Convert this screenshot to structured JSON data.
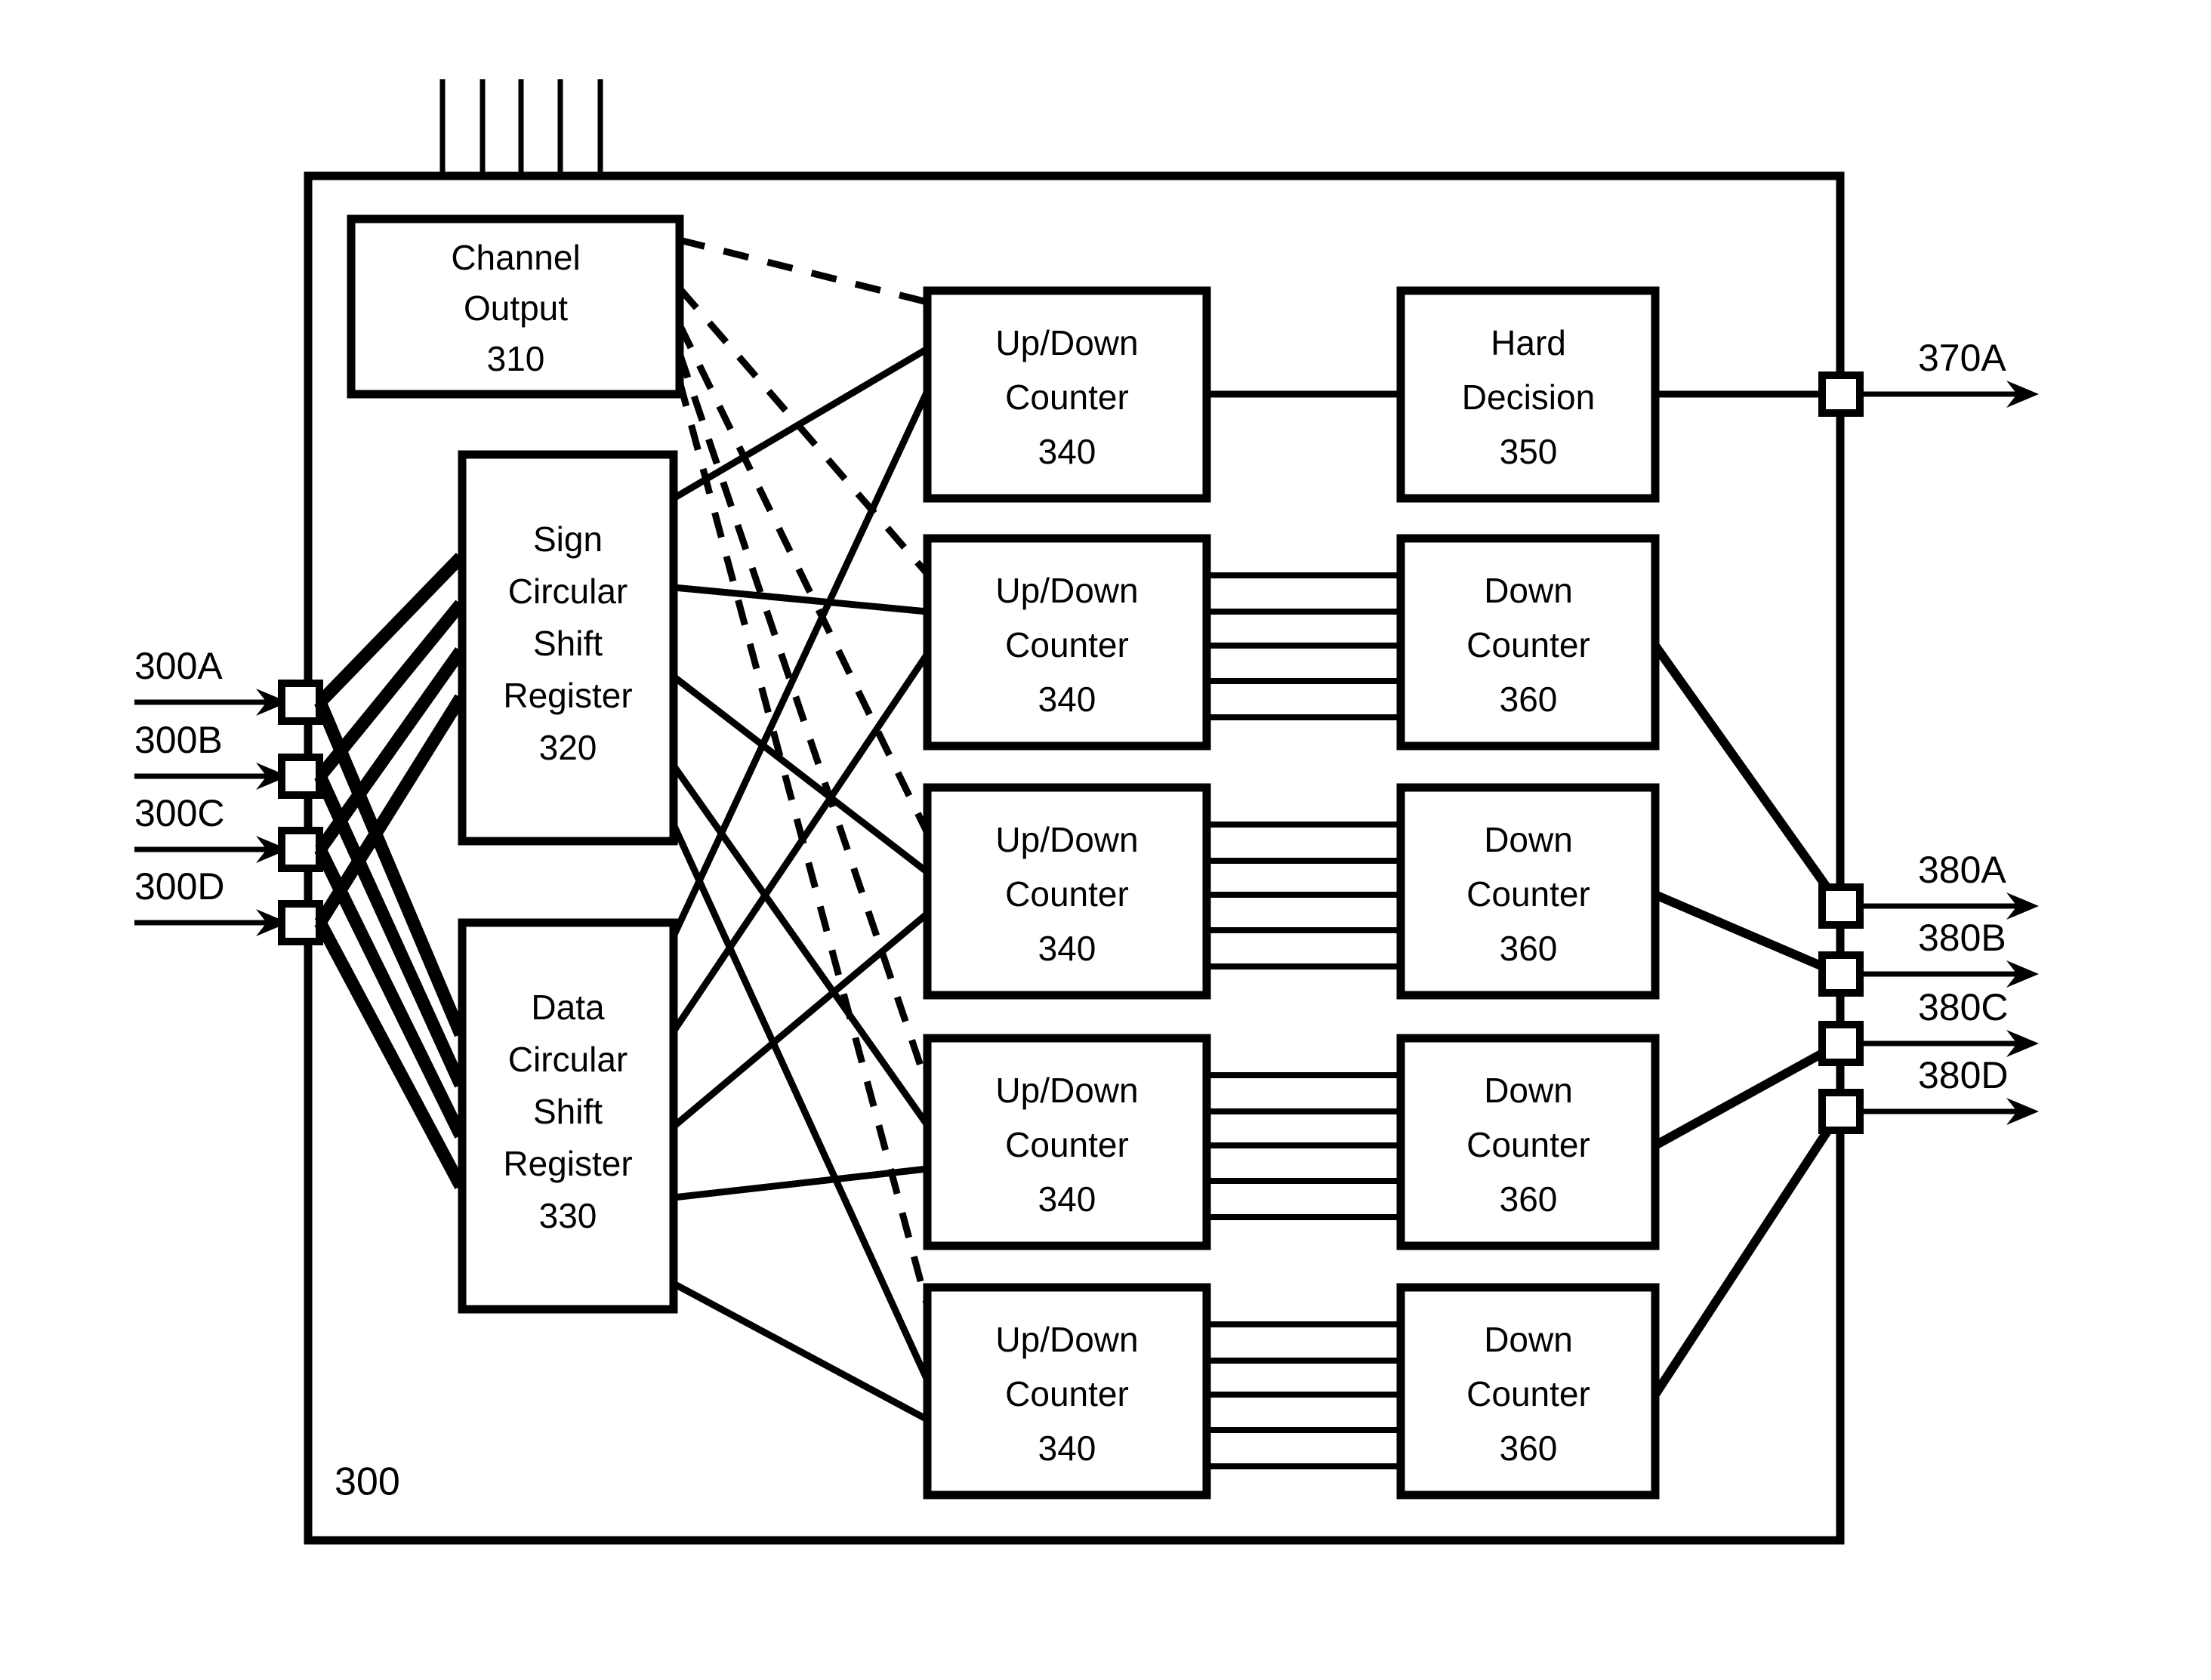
{
  "figure": {
    "outer_label": "300",
    "top_input_arrow_count": 5
  },
  "blocks": {
    "channel_output": {
      "line1": "Channel",
      "line2": "Output",
      "ref": "310"
    },
    "sign_shift_register": {
      "line1": "Sign",
      "line2": "Circular",
      "line3": "Shift",
      "line4": "Register",
      "ref": "320"
    },
    "data_shift_register": {
      "line1": "Data",
      "line2": "Circular",
      "line3": "Shift",
      "line4": "Register",
      "ref": "330"
    },
    "up_down_counter": {
      "line1": "Up/Down",
      "line2": "Counter",
      "ref": "340"
    },
    "hard_decision": {
      "line1": "Hard",
      "line2": "Decision",
      "ref": "350"
    },
    "down_counter": {
      "line1": "Down",
      "line2": "Counter",
      "ref": "360"
    }
  },
  "inputs": [
    {
      "label": "300A"
    },
    {
      "label": "300B"
    },
    {
      "label": "300C"
    },
    {
      "label": "300D"
    }
  ],
  "outputs_hard": [
    {
      "label": "370A"
    }
  ],
  "outputs_soft": [
    {
      "label": "380A"
    },
    {
      "label": "380B"
    },
    {
      "label": "380C"
    },
    {
      "label": "380D"
    }
  ],
  "rows": {
    "counter_rows": 5,
    "down_counter_rows": 4,
    "bus_lines_per_pair": 5
  },
  "colors": {
    "stroke": "#000000",
    "background": "#ffffff"
  }
}
